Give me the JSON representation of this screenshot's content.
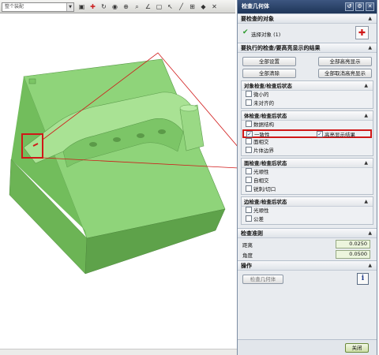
{
  "toolbar": {
    "filter_value": "整个装配",
    "icons": [
      "snap-icon",
      "view-icon",
      "rotate-icon",
      "select-icon",
      "fit-icon",
      "zoom-icon",
      "angle-icon",
      "line-icon"
    ]
  },
  "dialog": {
    "title": "检查几何体",
    "objects_section": "要检查的对象",
    "select_objects": "选择对象 (1)",
    "checks_section": "要执行的检查/要高亮显示的结果",
    "buttons": {
      "set_all": "全部设置",
      "highlight_all": "全部高亮显示",
      "clear_all": "全部清除",
      "unhighlight_all": "全部取消高亮显示"
    },
    "object_group": {
      "title": "对象检查/检查后状态",
      "items": [
        "微小的",
        "未对齐的"
      ]
    },
    "body_group": {
      "title": "体检查/检查后状态",
      "items": [
        "数据结构",
        "一致性",
        "面相交",
        "片体边界"
      ],
      "highlight_label": "高亮显示结果"
    },
    "face_group": {
      "title": "面检查/检查后状态",
      "items": [
        "光顺性",
        "自相交",
        "锐刺/切口"
      ]
    },
    "edge_group": {
      "title": "边检查/检查后状态",
      "items": [
        "光顺性",
        "公差"
      ]
    },
    "criteria_section": "检查准则",
    "distance_label": "距离",
    "distance_value": "0.0250",
    "angle_label": "角度",
    "angle_value": "0.0500",
    "ops_section": "操作",
    "check_button": "检查几何体",
    "info_icon": "info-icon",
    "close_button": "关闭"
  },
  "colors": {
    "model": "#8fd47a",
    "highlight": "#d01818",
    "titlebar": "#1e3558"
  }
}
